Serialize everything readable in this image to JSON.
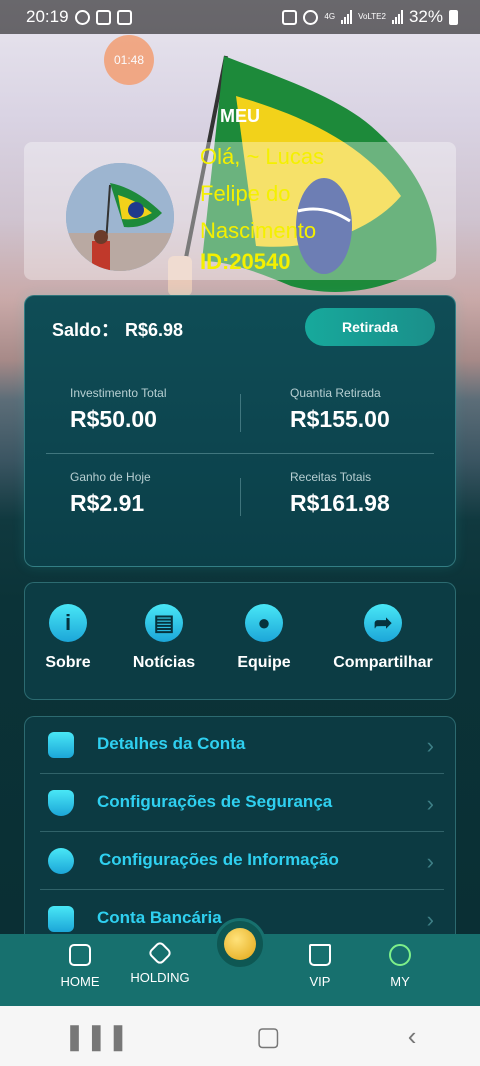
{
  "status_bar": {
    "time": "20:19",
    "network": "4G",
    "volte": "VoLTE2",
    "battery": "32%"
  },
  "overlay_timer": "01:48",
  "page_title": "MEU",
  "profile": {
    "greeting": "Olá, ~ Lucas Felipe do Nascimento",
    "user_id": "ID:20540"
  },
  "balance": {
    "label": "Saldo：",
    "value": "R$6.98",
    "withdraw_button": "Retirada",
    "stats": [
      {
        "label": "Investimento Total",
        "value": "R$50.00"
      },
      {
        "label": "Quantia Retirada",
        "value": "R$155.00"
      },
      {
        "label": "Ganho de Hoje",
        "value": "R$2.91"
      },
      {
        "label": "Receitas Totais",
        "value": "R$161.98"
      }
    ]
  },
  "actions": [
    {
      "label": "Sobre",
      "icon": "info-icon"
    },
    {
      "label": "Notícias",
      "icon": "news-icon"
    },
    {
      "label": "Equipe",
      "icon": "user-icon"
    },
    {
      "label": "Compartilhar",
      "icon": "share-icon"
    }
  ],
  "menu": [
    {
      "label": "Detalhes da Conta",
      "icon": "account-card-icon"
    },
    {
      "label": "Configurações de Segurança",
      "icon": "shield-icon"
    },
    {
      "label": "Configurações de Informação",
      "icon": "gear-icon"
    },
    {
      "label": "Conta Bancária",
      "icon": "bank-card-icon"
    }
  ],
  "tabs": [
    {
      "label": "HOME",
      "icon": "home-icon"
    },
    {
      "label": "HOLDING",
      "icon": "cube-icon"
    },
    {
      "label": "VIP",
      "icon": "crown-icon"
    },
    {
      "label": "MY",
      "icon": "face-icon"
    }
  ],
  "colors": {
    "accent": "#2fd0f0",
    "greeting": "#f4f000",
    "tabbar": "#17706e",
    "button": "#17a99c"
  }
}
